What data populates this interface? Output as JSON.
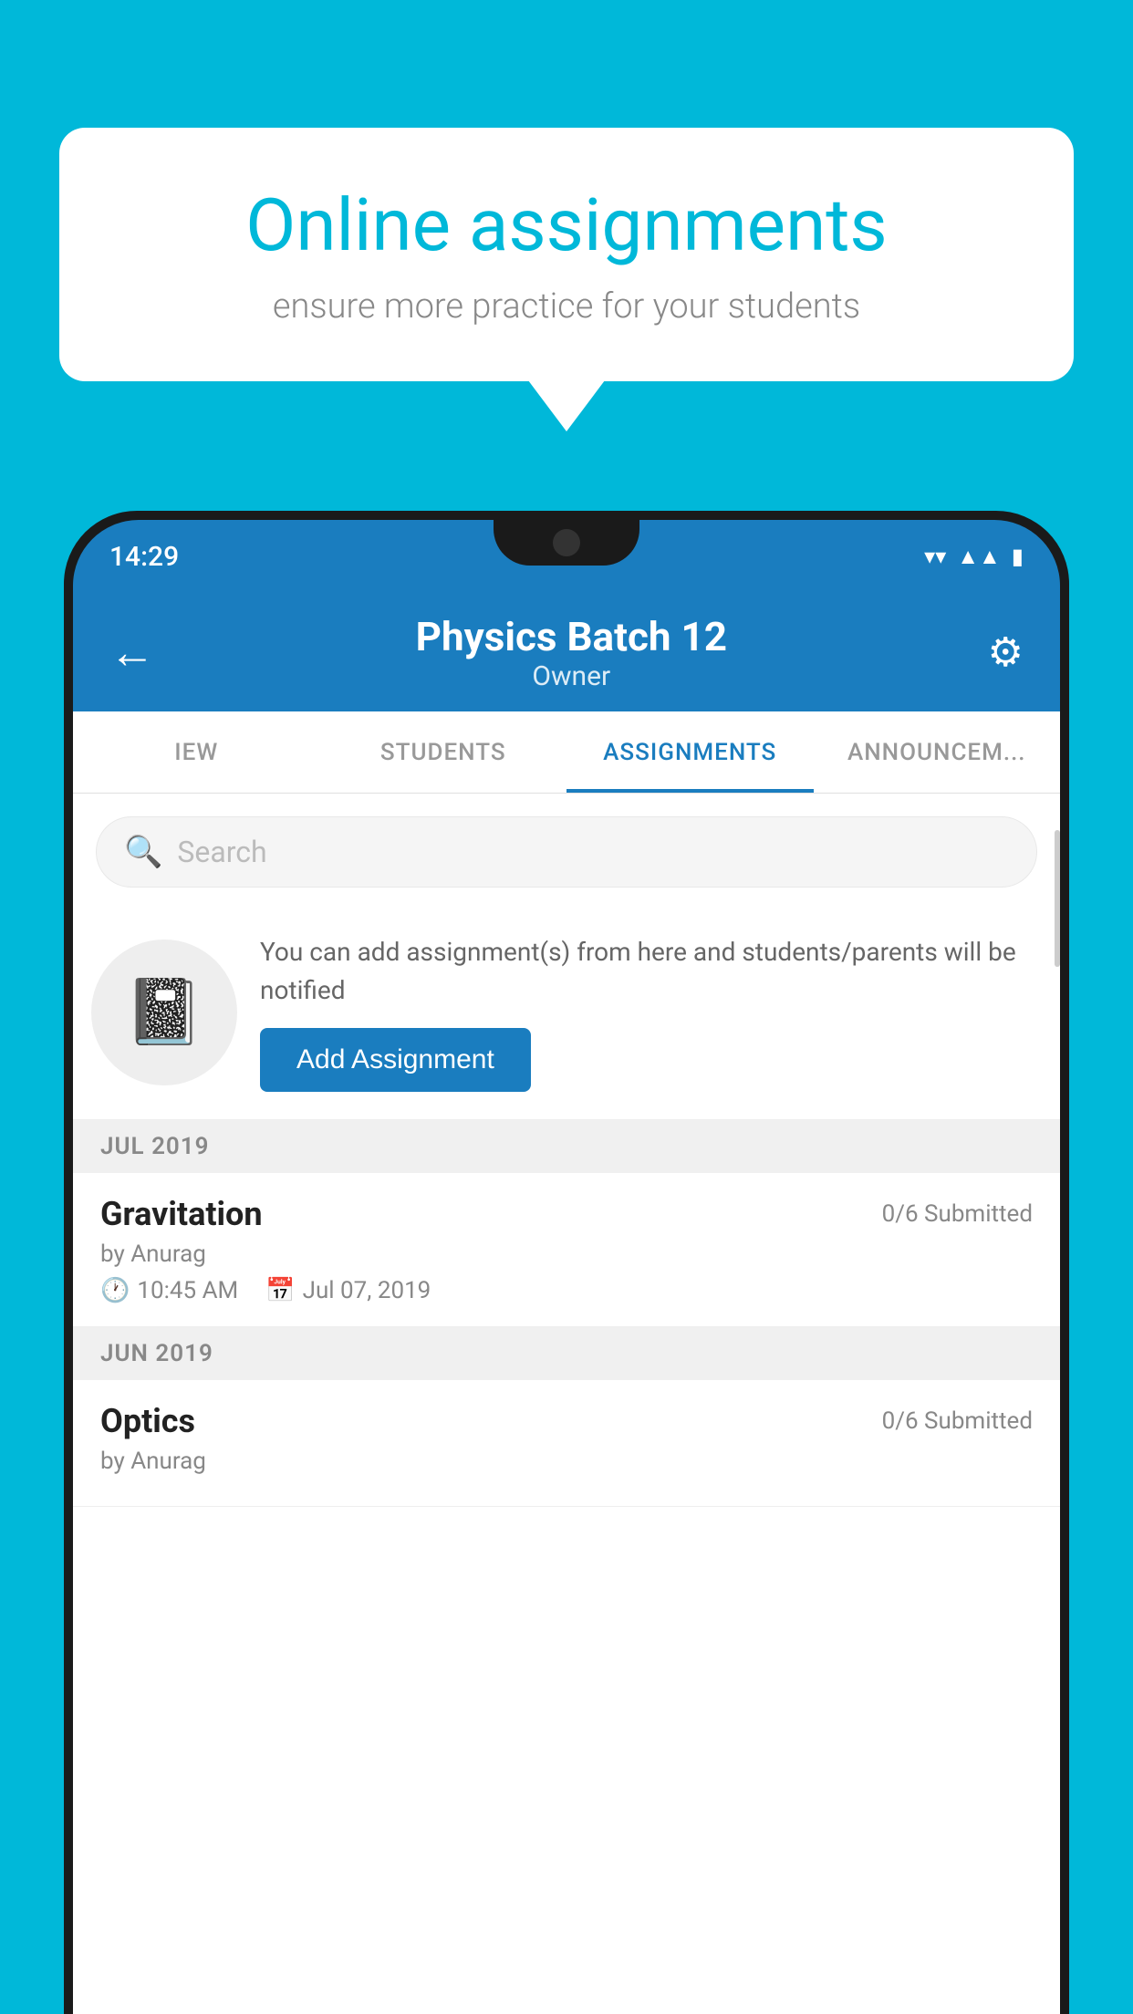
{
  "background_color": "#00B8D9",
  "speech_bubble": {
    "title": "Online assignments",
    "subtitle": "ensure more practice for your students"
  },
  "status_bar": {
    "time": "14:29",
    "wifi_icon": "▼",
    "signal_icon": "▲",
    "battery_icon": "▮"
  },
  "header": {
    "title": "Physics Batch 12",
    "subtitle": "Owner",
    "back_icon": "←",
    "settings_icon": "⚙"
  },
  "tabs": [
    {
      "label": "IEW",
      "active": false
    },
    {
      "label": "STUDENTS",
      "active": false
    },
    {
      "label": "ASSIGNMENTS",
      "active": true
    },
    {
      "label": "ANNOUNCEM...",
      "active": false
    }
  ],
  "search": {
    "placeholder": "Search"
  },
  "promo": {
    "description": "You can add assignment(s) from here and students/parents will be notified",
    "button_label": "Add Assignment"
  },
  "sections": [
    {
      "header": "JUL 2019",
      "items": [
        {
          "title": "Gravitation",
          "submitted": "0/6 Submitted",
          "author": "by Anurag",
          "time": "10:45 AM",
          "date": "Jul 07, 2019"
        }
      ]
    },
    {
      "header": "JUN 2019",
      "items": [
        {
          "title": "Optics",
          "submitted": "0/6 Submitted",
          "author": "by Anurag",
          "time": "",
          "date": ""
        }
      ]
    }
  ]
}
